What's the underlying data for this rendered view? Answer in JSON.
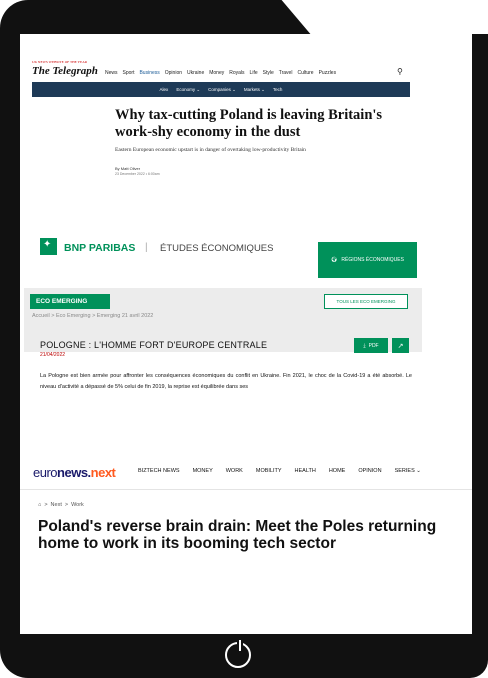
{
  "telegraph": {
    "tagline": "UK NEWS WEBSITE OF THE YEAR",
    "logo": "The Telegraph",
    "nav": [
      "News",
      "Sport",
      "Business",
      "Opinion",
      "Ukraine",
      "Money",
      "Royals",
      "Life",
      "Style",
      "Travel",
      "Culture",
      "Puzzles"
    ],
    "active_nav": "Business",
    "subnav": [
      "Alex",
      "Economy ⌄",
      "Companies ⌄",
      "Markets ⌄",
      "Tech"
    ],
    "headline": "Why tax-cutting Poland is leaving Britain's work-shy economy in the dust",
    "standfirst": "Eastern European economic upstart is in danger of overtaking low-productivity Britain",
    "byline": "By Matt Oliver",
    "date": "23 December 2022 • 6:00am",
    "search_icon": "search-icon"
  },
  "bnp": {
    "brand": "BNP PARIBAS",
    "separator": "|",
    "etudes": "ÉTUDES ÉCONOMIQUES",
    "regions_button": "RÉGIONS ÉCONOMIQUES",
    "eco_tag": "ECO EMERGING",
    "tous_button": "TOUS LES ECO EMERGING",
    "breadcrumb": "Accueil > Eco Emerging > Emerging 21 avril 2022",
    "title": "POLOGNE : L'HOMME FORT D'EUROPE CENTRALE",
    "date": "21/04/2022",
    "pdf_button": "PDF",
    "body": "La Pologne est bien armée pour affronter les conséquences économiques du conflit en Ukraine. Fin 2021, le choc de la Covid-19 a été absorbé. Le niveau d'activité a dépassé de 5% celui de fin 2019, la reprise est équilibrée dans ses",
    "brand_color": "#00915a"
  },
  "euronews": {
    "logo_a": "euro",
    "logo_b": "news.",
    "logo_c": "next",
    "nav": [
      "BIZTECH NEWS",
      "MONEY",
      "WORK",
      "MOBILITY",
      "HEALTH",
      "HOME",
      "OPINION",
      "SERIES ⌄"
    ],
    "breadcrumb": [
      "Next",
      "Work"
    ],
    "headline": "Poland's reverse brain drain: Meet the Poles returning home to work in its booming tech sector",
    "accent_color": "#ff5a1f"
  }
}
